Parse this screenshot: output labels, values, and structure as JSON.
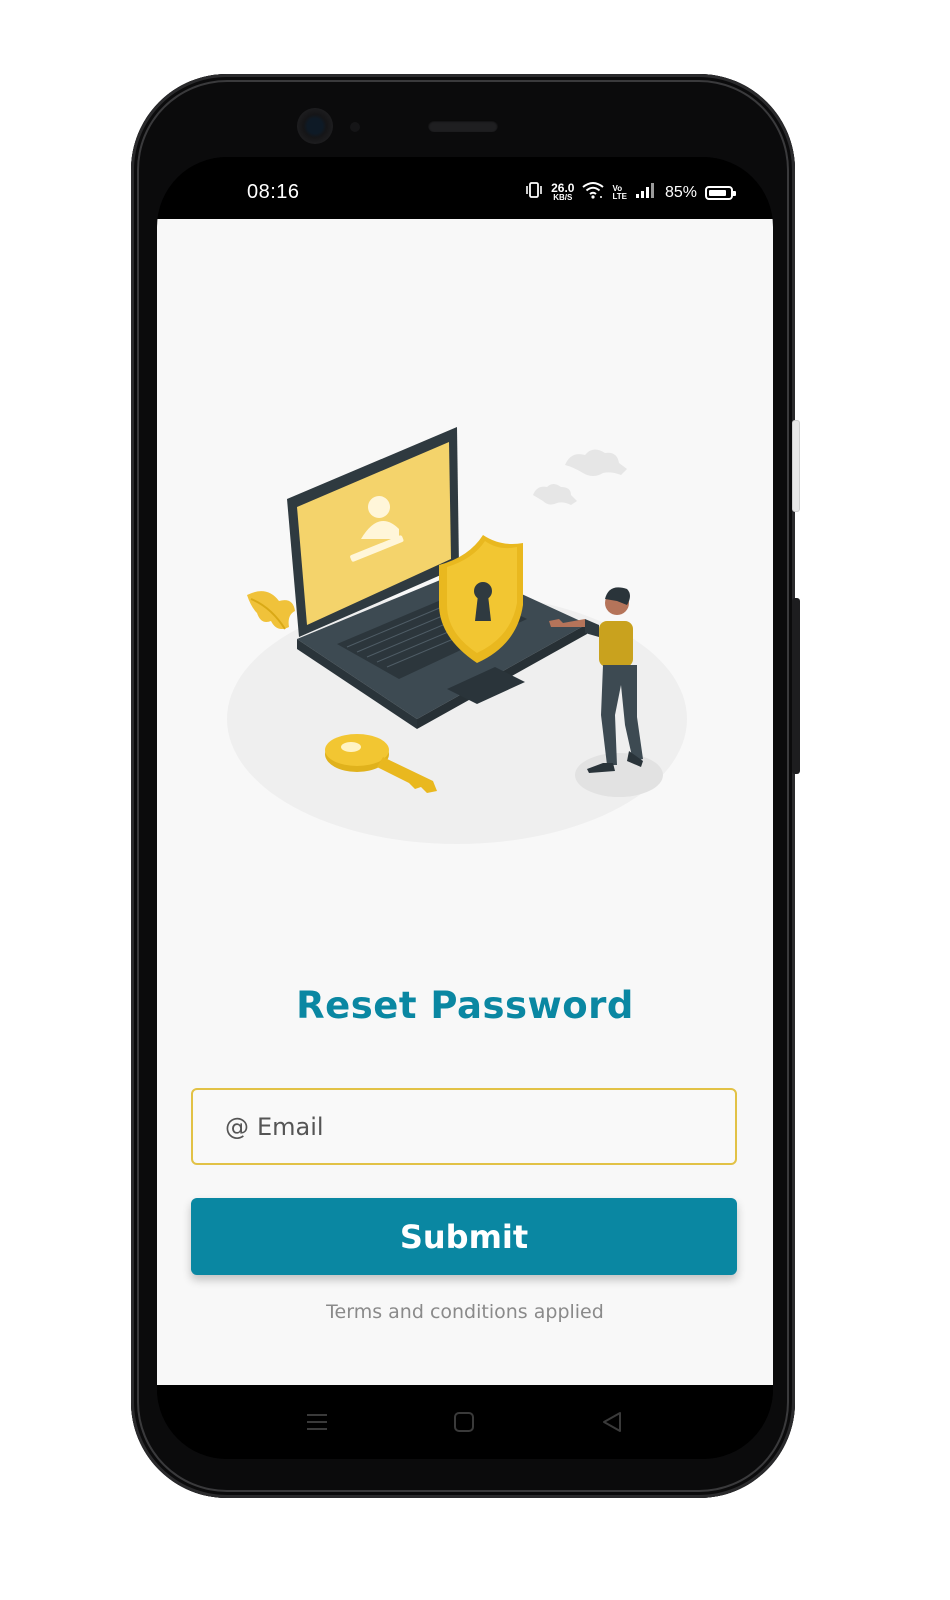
{
  "status_bar": {
    "time": "08:16",
    "net_speed_value": "26.0",
    "net_speed_unit": "KB/S",
    "volte_top": "Vo",
    "volte_bottom": "LTE",
    "battery_percent_text": "85%",
    "battery_level": 0.85,
    "icons": [
      "vibrate-icon",
      "wifi-icon",
      "signal-icon",
      "battery-icon"
    ]
  },
  "screen": {
    "title": "Reset Password",
    "email": {
      "prefix": "@",
      "placeholder": "Email",
      "value": ""
    },
    "submit_label": "Submit",
    "terms_text": "Terms and conditions applied",
    "illustration": "security-illustration-laptop-shield-key-person"
  },
  "nav_bar": {
    "buttons": [
      "menu-icon",
      "home-icon",
      "back-icon"
    ]
  },
  "colors": {
    "primary": "#0a87a2",
    "accent": "#e2c246",
    "background": "#f8f8f8",
    "muted_text": "#8a8a8a",
    "device": "#0b0b0c"
  }
}
